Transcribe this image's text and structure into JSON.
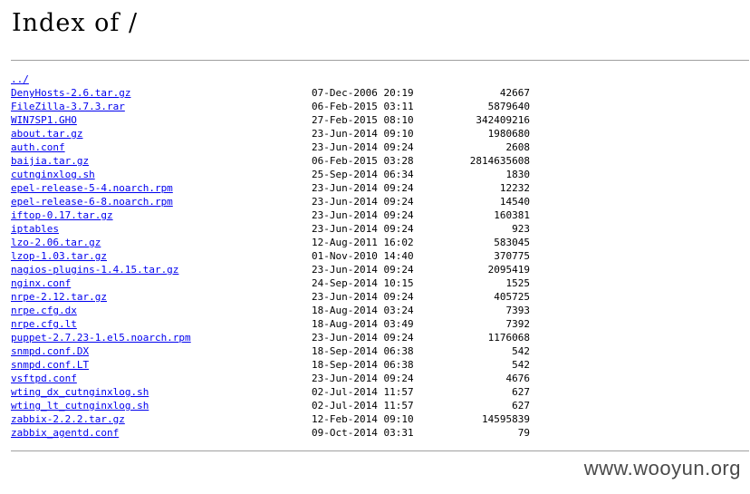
{
  "heading": "Index of /",
  "parent_link": "../",
  "files": [
    {
      "name": "DenyHosts-2.6.tar.gz",
      "date": "07-Dec-2006 20:19",
      "size": "42667"
    },
    {
      "name": "FileZilla-3.7.3.rar",
      "date": "06-Feb-2015 03:11",
      "size": "5879640"
    },
    {
      "name": "WIN7SP1.GHO",
      "date": "27-Feb-2015 08:10",
      "size": "342409216"
    },
    {
      "name": "about.tar.gz",
      "date": "23-Jun-2014 09:10",
      "size": "1980680"
    },
    {
      "name": "auth.conf",
      "date": "23-Jun-2014 09:24",
      "size": "2608"
    },
    {
      "name": "baijia.tar.gz",
      "date": "06-Feb-2015 03:28",
      "size": "2814635608"
    },
    {
      "name": "cutnginxlog.sh",
      "date": "25-Sep-2014 06:34",
      "size": "1830"
    },
    {
      "name": "epel-release-5-4.noarch.rpm",
      "date": "23-Jun-2014 09:24",
      "size": "12232"
    },
    {
      "name": "epel-release-6-8.noarch.rpm",
      "date": "23-Jun-2014 09:24",
      "size": "14540"
    },
    {
      "name": "iftop-0.17.tar.gz",
      "date": "23-Jun-2014 09:24",
      "size": "160381"
    },
    {
      "name": "iptables",
      "date": "23-Jun-2014 09:24",
      "size": "923"
    },
    {
      "name": "lzo-2.06.tar.gz",
      "date": "12-Aug-2011 16:02",
      "size": "583045"
    },
    {
      "name": "lzop-1.03.tar.gz",
      "date": "01-Nov-2010 14:40",
      "size": "370775"
    },
    {
      "name": "nagios-plugins-1.4.15.tar.gz",
      "date": "23-Jun-2014 09:24",
      "size": "2095419"
    },
    {
      "name": "nginx.conf",
      "date": "24-Sep-2014 10:15",
      "size": "1525"
    },
    {
      "name": "nrpe-2.12.tar.gz",
      "date": "23-Jun-2014 09:24",
      "size": "405725"
    },
    {
      "name": "nrpe.cfg.dx",
      "date": "18-Aug-2014 03:24",
      "size": "7393"
    },
    {
      "name": "nrpe.cfg.lt",
      "date": "18-Aug-2014 03:49",
      "size": "7392"
    },
    {
      "name": "puppet-2.7.23-1.el5.noarch.rpm",
      "date": "23-Jun-2014 09:24",
      "size": "1176068"
    },
    {
      "name": "snmpd.conf.DX",
      "date": "18-Sep-2014 06:38",
      "size": "542"
    },
    {
      "name": "snmpd.conf.LT",
      "date": "18-Sep-2014 06:38",
      "size": "542"
    },
    {
      "name": "vsftpd.conf",
      "date": "23-Jun-2014 09:24",
      "size": "4676"
    },
    {
      "name": "wting_dx_cutnginxlog.sh",
      "date": "02-Jul-2014 11:57",
      "size": "627"
    },
    {
      "name": "wting_lt_cutnginxlog.sh",
      "date": "02-Jul-2014 11:57",
      "size": "627"
    },
    {
      "name": "zabbix-2.2.2.tar.gz",
      "date": "12-Feb-2014 09:10",
      "size": "14595839"
    },
    {
      "name": "zabbix_agentd.conf",
      "date": "09-Oct-2014 03:31",
      "size": "79"
    }
  ],
  "watermark": "www.wooyun.org",
  "colors": {
    "link": "#0000ee",
    "rule": "#a0a0a0",
    "watermark": "#4a4a4a"
  }
}
